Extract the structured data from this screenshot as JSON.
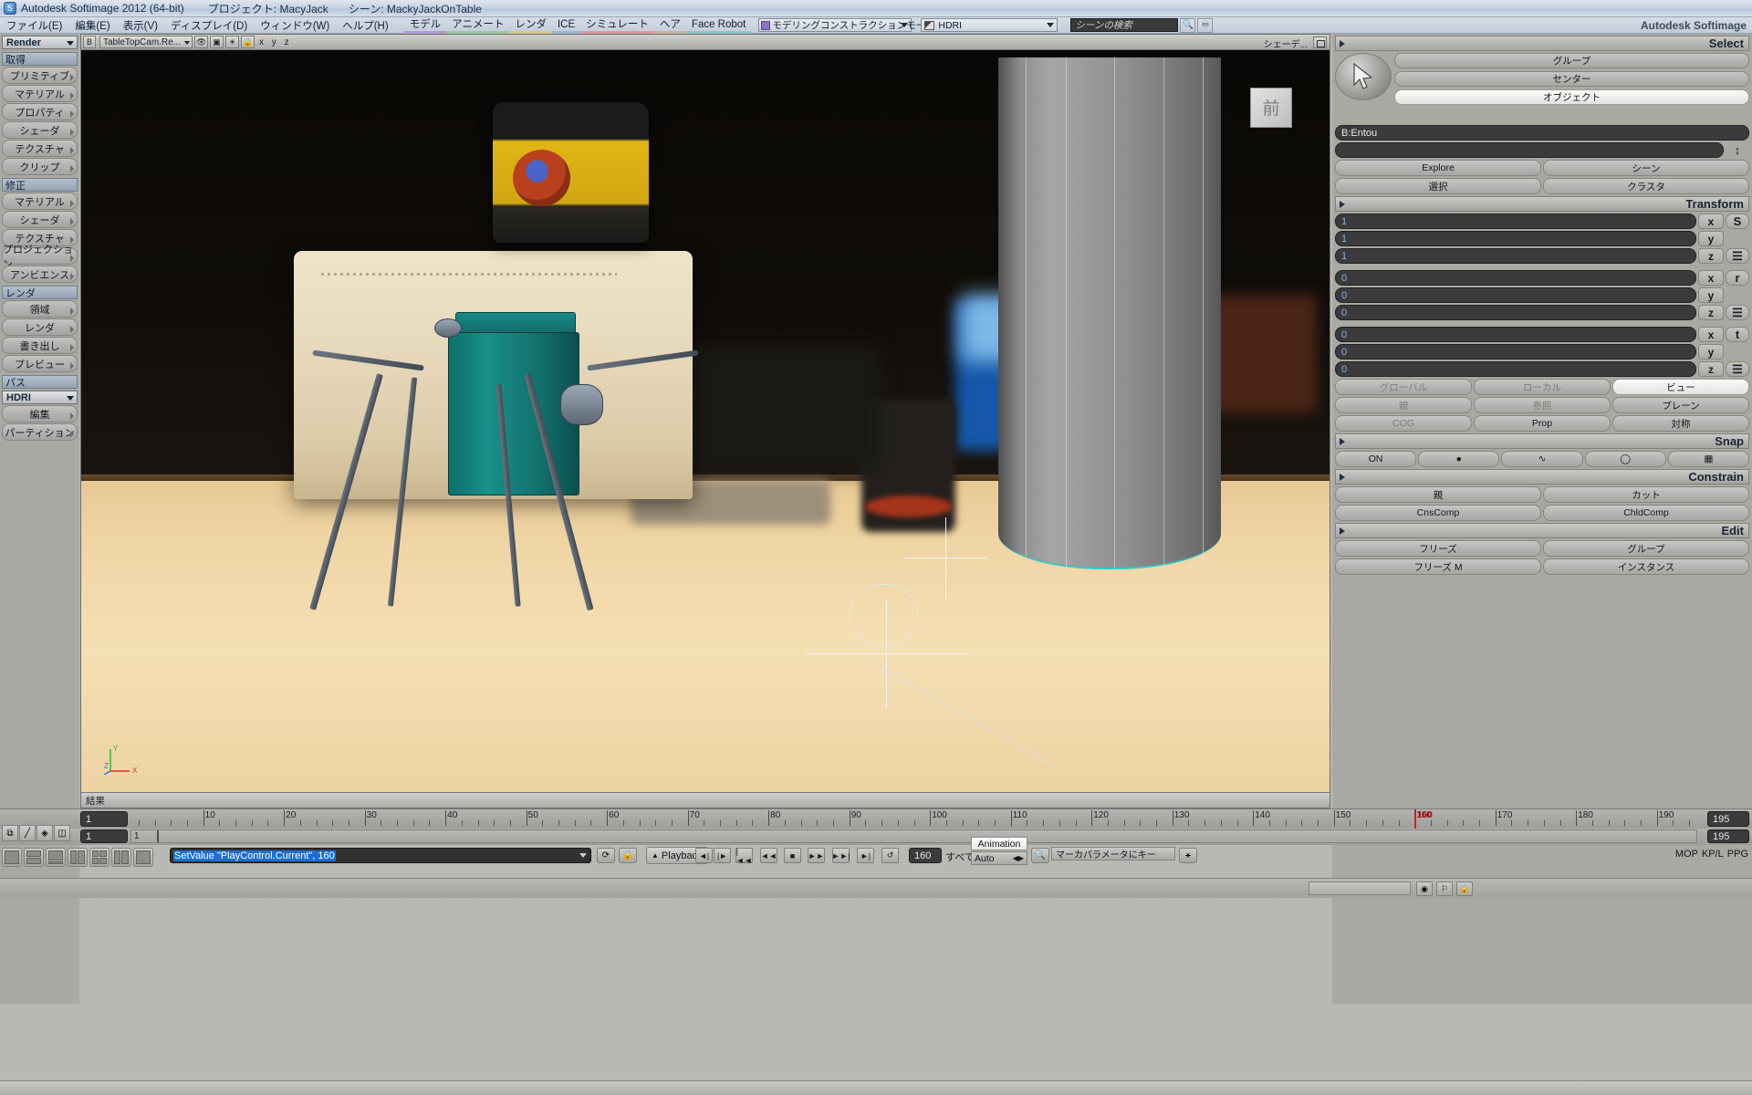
{
  "titlebar": {
    "app_title": "Autodesk Softimage 2012 (64-bit)",
    "project": "プロジェクト: MacyJack",
    "scene": "シーン: MackyJackOnTable",
    "window_icon": "softimage-logo-icon"
  },
  "menubar": {
    "items": [
      {
        "label": "ファイル(E)"
      },
      {
        "label": "編集(E)"
      },
      {
        "label": "表示(V)"
      },
      {
        "label": "ディスプレイ(D)"
      },
      {
        "label": "ウィンドウ(W)"
      },
      {
        "label": "ヘルプ(H)"
      }
    ],
    "modules": [
      {
        "label": "モデル",
        "color": "#b09ad0"
      },
      {
        "label": "アニメート",
        "color": "#9ec9a2"
      },
      {
        "label": "レンダ",
        "color": "#d3c98e"
      },
      {
        "label": "ICE",
        "color": "#9ab7d6"
      },
      {
        "label": "シミュレート",
        "color": "#d79ba0"
      },
      {
        "label": "ヘア",
        "color": "#c7b6a0"
      },
      {
        "label": "Face Robot",
        "color": "#8fc4c4"
      }
    ],
    "constraint_mode": "モデリングコンストラクションモード",
    "hdri_preset": "HDRI",
    "brand": "Autodesk Softimage"
  },
  "search": {
    "placeholder": "シーンの検索",
    "icon": "search-icon",
    "refresh_icon": "refresh-icon"
  },
  "left_sidebar": {
    "module_select": "Render",
    "groups": [
      {
        "header": "取得",
        "items": [
          "プリミティブ",
          "マテリアル",
          "プロパティ",
          "シェーダ",
          "テクスチャ",
          "クリップ"
        ]
      },
      {
        "header": "修正",
        "items": [
          "マテリアル",
          "シェーダ",
          "テクスチャ",
          "プロジェクション",
          "アンビエンス"
        ]
      },
      {
        "header": "レンダ",
        "items": [
          "領域",
          "レンダ",
          "書き出し",
          "プレビュー"
        ]
      },
      {
        "header": "パス",
        "items": []
      }
    ],
    "pass_select": "HDRI",
    "pass_items": [
      "編集",
      "パーティション"
    ]
  },
  "viewport": {
    "letter": "B",
    "camera": "TableTopCam.Re...",
    "axis_letters": "x y z",
    "shader_label": "シェーデ...",
    "status_label": "結果",
    "toolbar_icons": [
      "eye-icon",
      "camera-icon",
      "light-icon",
      "lock-icon",
      "maximize-icon"
    ],
    "nav_cube_label": "前",
    "axis_gizmo": {
      "y": "Y",
      "z": "Z",
      "x": "X"
    }
  },
  "right_panel": {
    "select": {
      "title": "Select",
      "cursor_icon": "arrow-cursor-icon",
      "buttons": [
        "グループ",
        "センター",
        "オブジェクト"
      ],
      "selected_object": "B:Entou",
      "nav_buttons": [
        "Explore",
        "シーン",
        "選択",
        "クラスタ"
      ]
    },
    "transform": {
      "title": "Transform",
      "scale": {
        "label": "S",
        "x": "1",
        "y": "1",
        "z": "1"
      },
      "rotate": {
        "label": "r",
        "x": "0",
        "y": "0",
        "z": "0"
      },
      "translate": {
        "label": "t",
        "x": "0",
        "y": "0",
        "z": "0"
      },
      "axis_labels": [
        "x",
        "y",
        "z"
      ],
      "ref_modes": [
        "グローバル",
        "ローカル",
        "ビュー"
      ],
      "ref_mode_active": "ビュー",
      "plane_modes": [
        "親",
        "参照",
        "プレーン"
      ],
      "plane_mode_active": "プレーン",
      "option_buttons": [
        "COG",
        "Prop",
        "対称"
      ]
    },
    "snap": {
      "title": "Snap",
      "toggle": "ON",
      "icons": [
        "snap-point-icon",
        "snap-curve-icon",
        "snap-surface-icon",
        "snap-grid-icon"
      ]
    },
    "constrain": {
      "title": "Constrain",
      "buttons": [
        "親",
        "カット",
        "CnsComp",
        "ChldComp"
      ]
    },
    "edit": {
      "title": "Edit",
      "buttons": [
        "フリーズ",
        "グループ",
        "フリーズ M",
        "インスタンス"
      ]
    }
  },
  "timeline": {
    "start_frame": "1",
    "end_frame": "195",
    "current_frame": "160",
    "playhead_label": "160",
    "sub_start": "1",
    "sub_left_label": "1",
    "sub_end": "195",
    "tick_labels": [
      "10",
      "20",
      "30",
      "40",
      "50",
      "60",
      "70",
      "80",
      "90",
      "100",
      "110",
      "120",
      "130",
      "140",
      "150",
      "160",
      "170",
      "180",
      "190"
    ],
    "range_min": 1,
    "range_max": 195
  },
  "command_bar": {
    "command_text": "SetValue \"PlayControl.Current\", 160",
    "playback_label": "Playback",
    "frame_value": "160",
    "all_label": "すべて",
    "animation_label": "Animation",
    "auto_label": "Auto",
    "marker_placeholder": "マーカパラメータにキー",
    "dropdown_icon": "chevron-down-icon",
    "snapshot_icon": "snapshot-icon",
    "lock_icon": "lock-icon",
    "transport": [
      {
        "name": "step-back-key-icon",
        "glyph": "◄|"
      },
      {
        "name": "step-forward-key-icon",
        "glyph": "|►"
      },
      {
        "name": "jump-start-icon",
        "glyph": "|◄◄"
      },
      {
        "name": "prev-frame-icon",
        "glyph": "◄◄"
      },
      {
        "name": "stop-icon",
        "glyph": "■"
      },
      {
        "name": "play-icon",
        "glyph": "►►"
      },
      {
        "name": "next-frame-icon",
        "glyph": "►►|"
      },
      {
        "name": "jump-end-icon",
        "glyph": "►|"
      },
      {
        "name": "loop-icon",
        "glyph": "↺"
      }
    ],
    "mop_buttons": [
      "MOP",
      "KP/L",
      "PPG"
    ]
  },
  "colors": {
    "panel_bg": "#a9a9a4",
    "chrome_light": "#c9cac7",
    "field_dark": "#3b3b3b",
    "accent_blue": "#1c6fd0",
    "playhead_red": "#d02020",
    "selection_teal": "#35c9c9",
    "number_blue": "#7fb9e8"
  }
}
